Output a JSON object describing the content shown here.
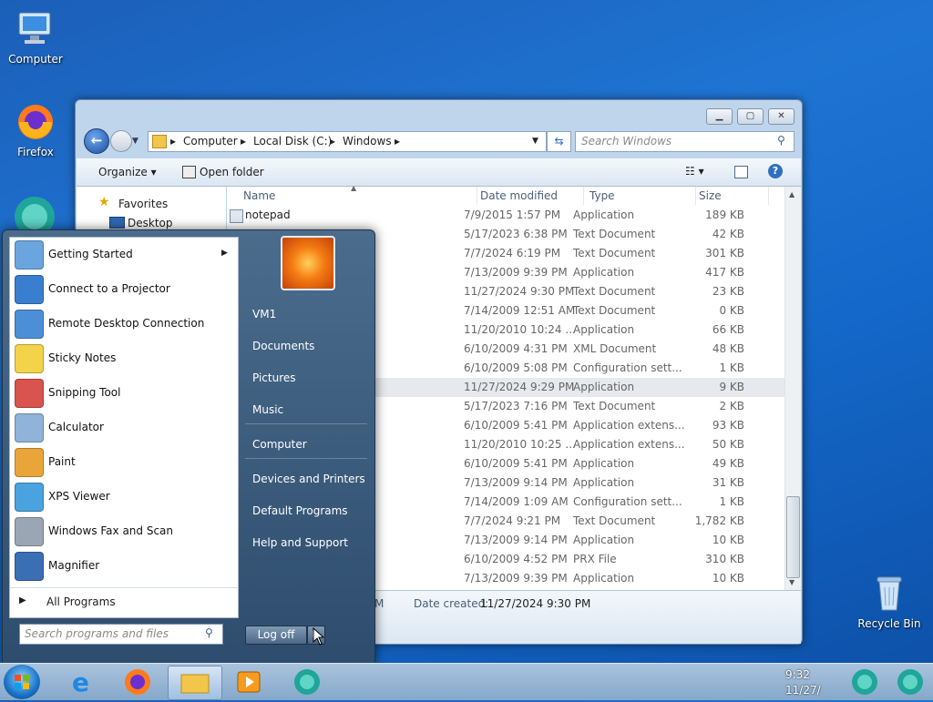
{
  "desktop": {
    "icons": [
      {
        "label": "Computer"
      },
      {
        "label": "Firefox"
      },
      {
        "label": "Recycle Bin"
      }
    ]
  },
  "explorer": {
    "breadcrumb": [
      "Computer",
      "Local Disk (C:)",
      "Windows"
    ],
    "search_placeholder": "Search Windows",
    "toolbar": {
      "organize": "Organize",
      "open_folder": "Open folder"
    },
    "nav": {
      "favorites": "Favorites",
      "desktop": "Desktop"
    },
    "columns": {
      "name": "Name",
      "date": "Date modified",
      "type": "Type",
      "size": "Size"
    },
    "rows": [
      {
        "name": "notepad",
        "date": "7/9/2015 1:57 PM",
        "type": "Application",
        "size": "189 KB"
      },
      {
        "name": "",
        "date": "5/17/2023 6:38 PM",
        "type": "Text Document",
        "size": "42 KB"
      },
      {
        "name": "",
        "date": "7/7/2024 6:19 PM",
        "type": "Text Document",
        "size": "301 KB"
      },
      {
        "name": "",
        "date": "7/13/2009 9:39 PM",
        "type": "Application",
        "size": "417 KB"
      },
      {
        "name": "",
        "date": "11/27/2024 9:30 PM",
        "type": "Text Document",
        "size": "23 KB"
      },
      {
        "name": "",
        "date": "7/14/2009 12:51 AM",
        "type": "Text Document",
        "size": "0 KB"
      },
      {
        "name": "",
        "date": "11/20/2010 10:24 ...",
        "type": "Application",
        "size": "66 KB"
      },
      {
        "name": "",
        "date": "6/10/2009 4:31 PM",
        "type": "XML Document",
        "size": "48 KB"
      },
      {
        "name": "",
        "date": "6/10/2009 5:08 PM",
        "type": "Configuration sett...",
        "size": "1 KB"
      },
      {
        "name": "",
        "date": "11/27/2024 9:29 PM",
        "type": "Application",
        "size": "9 KB"
      },
      {
        "name": "",
        "date": "5/17/2023 7:16 PM",
        "type": "Text Document",
        "size": "2 KB"
      },
      {
        "name": "",
        "date": "6/10/2009 5:41 PM",
        "type": "Application extens...",
        "size": "93 KB"
      },
      {
        "name": "",
        "date": "11/20/2010 10:25 ...",
        "type": "Application extens...",
        "size": "50 KB"
      },
      {
        "name": "",
        "date": "6/10/2009 5:41 PM",
        "type": "Application",
        "size": "49 KB"
      },
      {
        "name": "",
        "date": "7/13/2009 9:14 PM",
        "type": "Application",
        "size": "31 KB"
      },
      {
        "name": "",
        "date": "7/14/2009 1:09 AM",
        "type": "Configuration sett...",
        "size": "1 KB"
      },
      {
        "name": "",
        "date": "7/7/2024 9:21 PM",
        "type": "Text Document",
        "size": "1,782 KB"
      },
      {
        "name": "",
        "date": "7/13/2009 9:14 PM",
        "type": "Application",
        "size": "10 KB"
      },
      {
        "name": "",
        "date": "6/10/2009 4:52 PM",
        "type": "PRX File",
        "size": "310 KB"
      },
      {
        "name": "",
        "date": "7/13/2009 9:39 PM",
        "type": "Application",
        "size": "10 KB"
      }
    ],
    "details": {
      "partial_time": "M",
      "date_created_label": "Date created:",
      "date_created_value": "11/27/2024 9:30 PM"
    }
  },
  "start_menu": {
    "programs": [
      {
        "label": "Getting Started"
      },
      {
        "label": "Connect to a Projector"
      },
      {
        "label": "Remote Desktop Connection"
      },
      {
        "label": "Sticky Notes"
      },
      {
        "label": "Snipping Tool"
      },
      {
        "label": "Calculator"
      },
      {
        "label": "Paint"
      },
      {
        "label": "XPS Viewer"
      },
      {
        "label": "Windows Fax and Scan"
      },
      {
        "label": "Magnifier"
      }
    ],
    "all_programs": "All Programs",
    "search_placeholder": "Search programs and files",
    "right": [
      "VM1",
      "Documents",
      "Pictures",
      "Music",
      "Computer",
      "Devices and Printers",
      "Default Programs",
      "Help and Support"
    ],
    "logoff": "Log off"
  },
  "taskbar": {
    "clock_time": "9:32",
    "clock_date": "11/27/"
  }
}
